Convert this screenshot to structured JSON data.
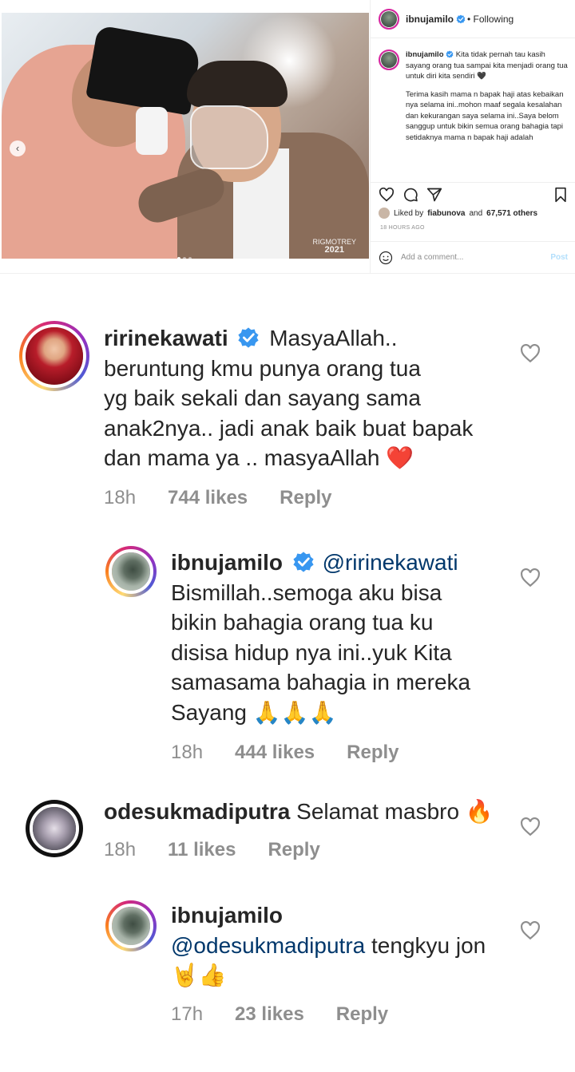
{
  "post": {
    "photo": {
      "watermark_line1": "RIGMOTREY",
      "watermark_line2": "2021"
    },
    "author": {
      "username": "ibnujamilo",
      "follow_status": "• Following"
    },
    "caption": {
      "username": "ibnujamilo",
      "paragraph1": "Kita tidak pernah tau kasih sayang orang tua sampai kita menjadi orang tua untuk diri kita sendiri 🖤",
      "paragraph2": "Terima kasih mama n bapak haji atas kebaikan nya selama ini..mohon maaf segala kesalahan dan kekurangan saya selama ini..Saya belom sanggup untuk bikin semua orang bahagia tapi setidaknya mama n bapak haji adalah"
    },
    "likes": {
      "prefix": "Liked by",
      "liked_by_user": "fiabunova",
      "and_text": "and",
      "others": "67,571 others"
    },
    "time_ago": "18 HOURS AGO",
    "comment_input": {
      "placeholder": "Add a comment...",
      "post_label": "Post"
    }
  },
  "comments": [
    {
      "username": "ririnekawati",
      "verified": true,
      "lines": [
        "MasyaAllah..",
        "beruntung kmu punya orang tua",
        "yg baik sekali dan sayang sama",
        "anak2nya.. jadi anak baik buat bapak",
        "dan mama ya .. masyaAllah ❤️"
      ],
      "time": "18h",
      "likes": "744 likes",
      "reply": "Reply"
    },
    {
      "username": "ibnujamilo",
      "verified": true,
      "mention": "@ririnekawati",
      "lines": [
        "Bismillah..semoga aku bisa",
        "bikin bahagia orang tua ku",
        "disisa hidup nya ini..yuk Kita",
        "samasama bahagia in mereka",
        "Sayang 🙏🙏🙏"
      ],
      "time": "18h",
      "likes": "444 likes",
      "reply": "Reply"
    },
    {
      "username": "odesukmadiputra",
      "verified": false,
      "lines": [
        "Selamat masbro 🔥"
      ],
      "time": "18h",
      "likes": "11 likes",
      "reply": "Reply"
    },
    {
      "username": "ibnujamilo",
      "verified": false,
      "mention": "@odesukmadiputra",
      "lines": [
        "tengkyu jon",
        "🤘👍"
      ],
      "time": "17h",
      "likes": "23 likes",
      "reply": "Reply"
    }
  ],
  "colors": {
    "verified_blue": "#3897f0",
    "mention_blue": "#00376b",
    "meta_gray": "#8e8e8e",
    "text": "#262626"
  }
}
